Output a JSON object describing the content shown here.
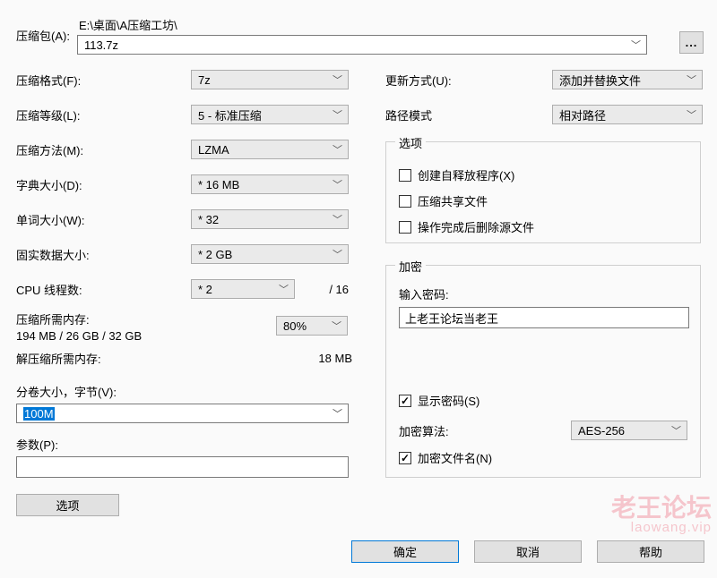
{
  "archive": {
    "label": "压缩包(A):",
    "path": "E:\\桌面\\A压缩工坊\\",
    "filename": "113.7z"
  },
  "left": {
    "format_label": "压缩格式(F):",
    "format_value": "7z",
    "level_label": "压缩等级(L):",
    "level_value": "5 - 标准压缩",
    "method_label": "压缩方法(M):",
    "method_value": "LZMA",
    "dict_label": "字典大小(D):",
    "dict_value": "* 16 MB",
    "word_label": "单词大小(W):",
    "word_value": "* 32",
    "solid_label": "固实数据大小:",
    "solid_value": "* 2 GB",
    "threads_label": "CPU 线程数:",
    "threads_value": "* 2",
    "threads_total": "/ 16",
    "mem_compress_label": "压缩所需内存:",
    "mem_compress_value": "194 MB / 26 GB / 32 GB",
    "mem_percent": "80%",
    "mem_decompress_label": "解压缩所需内存:",
    "mem_decompress_value": "18 MB",
    "volume_label": "分卷大小，字节(V):",
    "volume_value": "100M",
    "params_label": "参数(P):",
    "params_value": "",
    "options_button": "选项"
  },
  "right": {
    "update_label": "更新方式(U):",
    "update_value": "添加并替换文件",
    "path_label": "路径模式",
    "path_value": "相对路径",
    "options_legend": "选项",
    "opt_sfx": "创建自释放程序(X)",
    "opt_share": "压缩共享文件",
    "opt_delete": "操作完成后删除源文件",
    "encrypt_legend": "加密",
    "pw_label": "输入密码:",
    "pw_value": "上老王论坛当老王",
    "show_pw": "显示密码(S)",
    "show_pw_checked": true,
    "algo_label": "加密算法:",
    "algo_value": "AES-256",
    "encrypt_names": "加密文件名(N)",
    "encrypt_names_checked": true
  },
  "buttons": {
    "ok": "确定",
    "cancel": "取消",
    "help": "帮助"
  },
  "watermark": {
    "line1": "老王论坛",
    "line2": "laowang.vip"
  }
}
